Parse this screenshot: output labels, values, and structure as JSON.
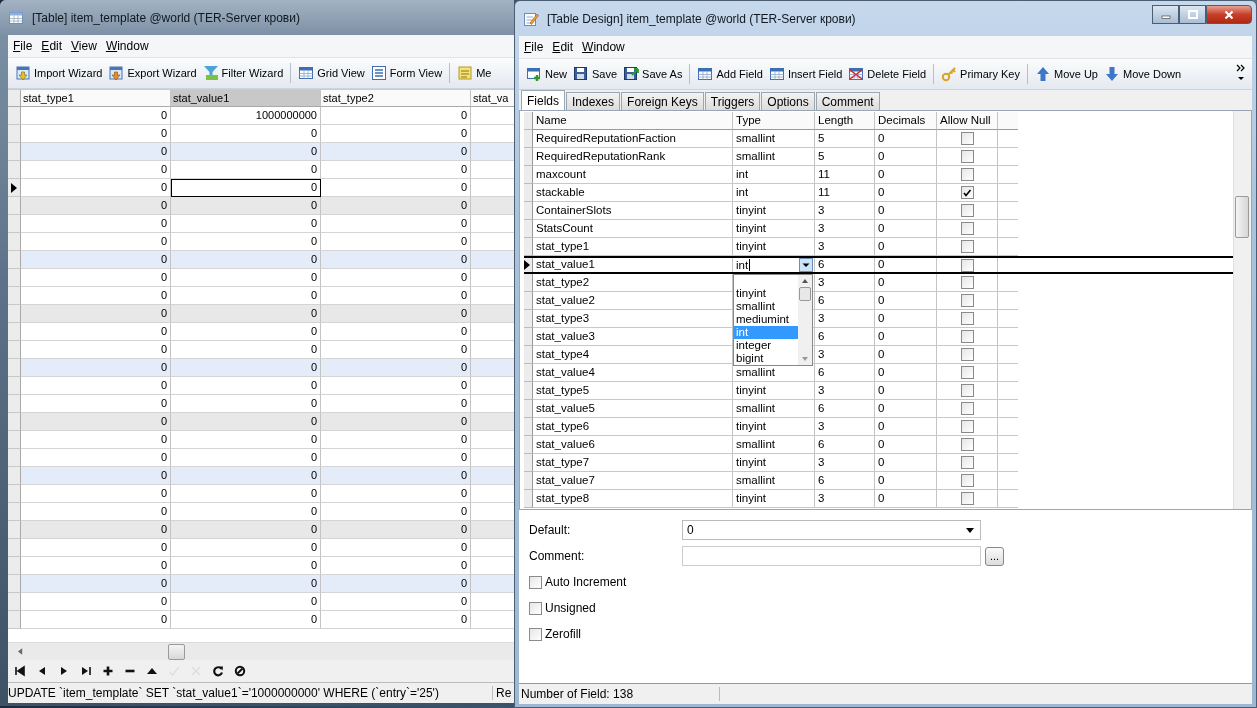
{
  "left_window": {
    "title": "[Table] item_template @world (TER-Server крови)",
    "menu": [
      "File",
      "Edit",
      "View",
      "Window"
    ],
    "toolbar": [
      [
        "Import Wizard",
        "Export Wizard",
        "Filter Wizard"
      ],
      [
        "Grid View",
        "Form View"
      ],
      [
        "Me"
      ]
    ],
    "grid": {
      "columns": [
        {
          "label": "stat_type1",
          "selected": false
        },
        {
          "label": "stat_value1",
          "selected": true
        },
        {
          "label": "stat_type2",
          "selected": false
        },
        {
          "label": "stat_va",
          "selected": false
        }
      ],
      "rows": [
        {
          "cells": [
            "0",
            "1000000000",
            "0"
          ],
          "selected": false
        },
        {
          "cells": [
            "0",
            "0",
            "0"
          ],
          "selected": false
        },
        {
          "cells": [
            "0",
            "0",
            "0"
          ],
          "selected": false
        },
        {
          "cells": [
            "0",
            "0",
            "0"
          ],
          "selected": false
        },
        {
          "cells": [
            "0",
            "0",
            "0"
          ],
          "selected": true
        },
        {
          "cells": [
            "0",
            "0",
            "0"
          ],
          "selected": false
        },
        {
          "cells": [
            "0",
            "0",
            "0"
          ],
          "selected": false
        },
        {
          "cells": [
            "0",
            "0",
            "0"
          ],
          "selected": false
        },
        {
          "cells": [
            "0",
            "0",
            "0"
          ],
          "selected": false
        },
        {
          "cells": [
            "0",
            "0",
            "0"
          ],
          "selected": false
        },
        {
          "cells": [
            "0",
            "0",
            "0"
          ],
          "selected": false
        },
        {
          "cells": [
            "0",
            "0",
            "0"
          ],
          "selected": false
        },
        {
          "cells": [
            "0",
            "0",
            "0"
          ],
          "selected": false
        },
        {
          "cells": [
            "0",
            "0",
            "0"
          ],
          "selected": false
        },
        {
          "cells": [
            "0",
            "0",
            "0"
          ],
          "selected": false
        },
        {
          "cells": [
            "0",
            "0",
            "0"
          ],
          "selected": false
        },
        {
          "cells": [
            "0",
            "0",
            "0"
          ],
          "selected": false
        },
        {
          "cells": [
            "0",
            "0",
            "0"
          ],
          "selected": false
        },
        {
          "cells": [
            "0",
            "0",
            "0"
          ],
          "selected": false
        },
        {
          "cells": [
            "0",
            "0",
            "0"
          ],
          "selected": false
        },
        {
          "cells": [
            "0",
            "0",
            "0"
          ],
          "selected": false
        },
        {
          "cells": [
            "0",
            "0",
            "0"
          ],
          "selected": false
        },
        {
          "cells": [
            "0",
            "0",
            "0"
          ],
          "selected": false
        },
        {
          "cells": [
            "0",
            "0",
            "0"
          ],
          "selected": false
        },
        {
          "cells": [
            "0",
            "0",
            "0"
          ],
          "selected": false
        },
        {
          "cells": [
            "0",
            "0",
            "0"
          ],
          "selected": false
        },
        {
          "cells": [
            "0",
            "0",
            "0"
          ],
          "selected": false
        },
        {
          "cells": [
            "0",
            "0",
            "0"
          ],
          "selected": false
        },
        {
          "cells": [
            "0",
            "0",
            "0"
          ],
          "selected": false
        }
      ]
    },
    "nav_buttons": [
      {
        "disabled": false
      },
      {
        "disabled": false
      },
      {
        "disabled": false
      },
      {
        "disabled": false
      },
      {
        "disabled": false
      },
      {
        "disabled": false
      },
      {
        "disabled": false
      },
      {
        "disabled": true
      },
      {
        "disabled": true
      },
      {
        "disabled": false
      },
      {
        "disabled": false
      }
    ],
    "status": "UPDATE `item_template` SET `stat_value1`='1000000000' WHERE (`entry`='25')",
    "status_2": "Re"
  },
  "right_window": {
    "title": "[Table Design] item_template @world (TER-Server крови)",
    "menu": [
      "File",
      "Edit",
      "Window"
    ],
    "toolbar": [
      [
        "New",
        "Save",
        "Save As"
      ],
      [
        "Add Field",
        "Insert Field",
        "Delete Field"
      ],
      [
        "Primary Key"
      ],
      [
        "Move Up",
        "Move Down"
      ]
    ],
    "tabs": [
      {
        "label": "Fields",
        "selected": true
      },
      {
        "label": "Indexes",
        "selected": false
      },
      {
        "label": "Foreign Keys",
        "selected": false
      },
      {
        "label": "Triggers",
        "selected": false
      },
      {
        "label": "Options",
        "selected": false
      },
      {
        "label": "Comment",
        "selected": false
      }
    ],
    "fields": {
      "columns": [
        "Name",
        "Type",
        "Length",
        "Decimals",
        "Allow Null"
      ],
      "rows": [
        {
          "name": "RequiredReputationFaction",
          "type": "smallint",
          "length": "5",
          "decimals": "0",
          "allow_null": false,
          "selected": false
        },
        {
          "name": "RequiredReputationRank",
          "type": "smallint",
          "length": "5",
          "decimals": "0",
          "allow_null": false,
          "selected": false
        },
        {
          "name": "maxcount",
          "type": "int",
          "length": "11",
          "decimals": "0",
          "allow_null": false,
          "selected": false
        },
        {
          "name": "stackable",
          "type": "int",
          "length": "11",
          "decimals": "0",
          "allow_null": true,
          "selected": false
        },
        {
          "name": "ContainerSlots",
          "type": "tinyint",
          "length": "3",
          "decimals": "0",
          "allow_null": false,
          "selected": false
        },
        {
          "name": "StatsCount",
          "type": "tinyint",
          "length": "3",
          "decimals": "0",
          "allow_null": false,
          "selected": false
        },
        {
          "name": "stat_type1",
          "type": "tinyint",
          "length": "3",
          "decimals": "0",
          "allow_null": false,
          "selected": false
        },
        {
          "name": "stat_value1",
          "type": "int",
          "length": "6",
          "decimals": "0",
          "allow_null": false,
          "selected": true
        },
        {
          "name": "stat_type2",
          "length": "3",
          "decimals": "0",
          "allow_null": false,
          "selected": false
        },
        {
          "name": "stat_value2",
          "length": "6",
          "decimals": "0",
          "allow_null": false,
          "selected": false
        },
        {
          "name": "stat_type3",
          "length": "3",
          "decimals": "0",
          "allow_null": false,
          "selected": false
        },
        {
          "name": "stat_value3",
          "length": "6",
          "decimals": "0",
          "allow_null": false,
          "selected": false
        },
        {
          "name": "stat_type4",
          "length": "3",
          "decimals": "0",
          "allow_null": false,
          "selected": false
        },
        {
          "name": "stat_value4",
          "type": "smallint",
          "length": "6",
          "decimals": "0",
          "allow_null": false,
          "selected": false
        },
        {
          "name": "stat_type5",
          "type": "tinyint",
          "length": "3",
          "decimals": "0",
          "allow_null": false,
          "selected": false
        },
        {
          "name": "stat_value5",
          "type": "smallint",
          "length": "6",
          "decimals": "0",
          "allow_null": false,
          "selected": false
        },
        {
          "name": "stat_type6",
          "type": "tinyint",
          "length": "3",
          "decimals": "0",
          "allow_null": false,
          "selected": false
        },
        {
          "name": "stat_value6",
          "type": "smallint",
          "length": "6",
          "decimals": "0",
          "allow_null": false,
          "selected": false
        },
        {
          "name": "stat_type7",
          "type": "tinyint",
          "length": "3",
          "decimals": "0",
          "allow_null": false,
          "selected": false
        },
        {
          "name": "stat_value7",
          "type": "smallint",
          "length": "6",
          "decimals": "0",
          "allow_null": false,
          "selected": false
        },
        {
          "name": "stat_type8",
          "type": "tinyint",
          "length": "3",
          "decimals": "0",
          "allow_null": false,
          "selected": false
        }
      ]
    },
    "type_dropdown": {
      "options": [
        {
          "label": "tinyint",
          "selected": false
        },
        {
          "label": "smallint",
          "selected": false
        },
        {
          "label": "mediumint",
          "selected": false
        },
        {
          "label": "int",
          "selected": true
        },
        {
          "label": "integer",
          "selected": false
        },
        {
          "label": "bigint",
          "selected": false
        }
      ]
    },
    "default_field": {
      "label": "Default:",
      "value": "0"
    },
    "comment_field": {
      "label": "Comment:",
      "button": "..."
    },
    "options": [
      {
        "label": "Auto Increment",
        "checked": false
      },
      {
        "label": "Unsigned",
        "checked": false
      },
      {
        "label": "Zerofill",
        "checked": false
      }
    ],
    "status": "Number of Field: 138"
  }
}
